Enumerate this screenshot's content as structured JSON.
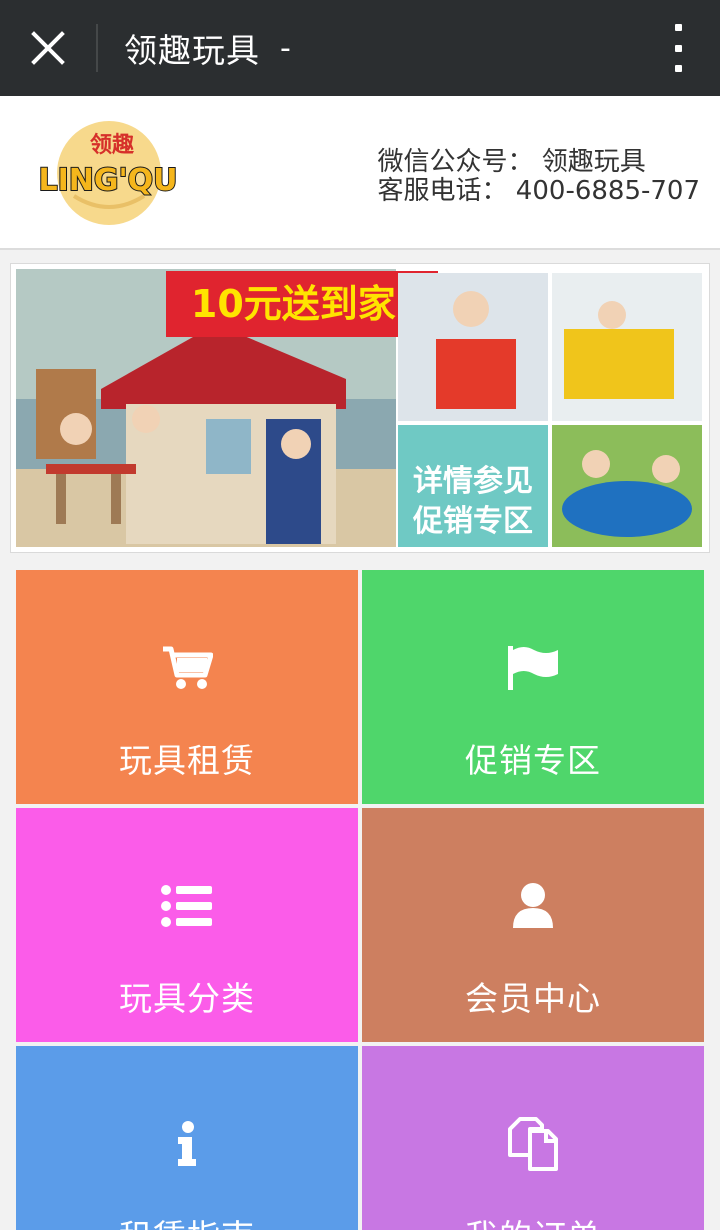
{
  "topbar": {
    "title": "领趣玩具",
    "suffix": "-"
  },
  "header": {
    "logo_text_cn": "领趣",
    "logo_text_en": "LING'QU",
    "wechat_line": "微信公众号： 领趣玩具",
    "phone_line": "客服电话： 400-6885-707"
  },
  "banner": {
    "headline": "10元送到家!",
    "promo_line1": "详情参见",
    "promo_line2": "促销专区"
  },
  "tiles": [
    {
      "label": "玩具租赁",
      "icon": "cart-icon",
      "color": "#f4844f"
    },
    {
      "label": "促销专区",
      "icon": "flag-icon",
      "color": "#4fd66b"
    },
    {
      "label": "玩具分类",
      "icon": "list-icon",
      "color": "#fb5ce9"
    },
    {
      "label": "会员中心",
      "icon": "user-icon",
      "color": "#cd7f60"
    },
    {
      "label": "租赁指南",
      "icon": "info-icon",
      "color": "#5b9ce9"
    },
    {
      "label": "我的订单",
      "icon": "copy-icon",
      "color": "#c877e3"
    }
  ]
}
